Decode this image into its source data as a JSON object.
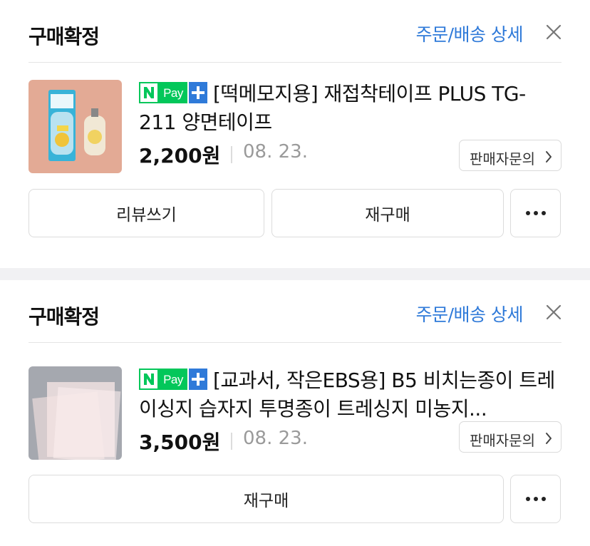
{
  "orders": [
    {
      "status": "구매확정",
      "detail_link": "주문/배송 상세",
      "npay_badge": {
        "n": "N",
        "pay": "Pay",
        "plus": "+"
      },
      "title": "[떡메모지용] 재접착테이프 PLUS TG-211 양면테이프",
      "price": "2,200원",
      "date": "08. 23.",
      "seller_inquiry": "판매자문의",
      "actions": [
        "리뷰쓰기",
        "재구매"
      ]
    },
    {
      "status": "구매확정",
      "detail_link": "주문/배송 상세",
      "npay_badge": {
        "n": "N",
        "pay": "Pay",
        "plus": "+"
      },
      "title": "[교과서, 작은EBS용] B5 비치는종이 트레이싱지 습자지 투명종이 트레싱지 미농지...",
      "price": "3,500원",
      "date": "08. 23.",
      "seller_inquiry": "판매자문의",
      "actions": [
        "재구매"
      ]
    }
  ],
  "colors": {
    "link": "#2f7ad9",
    "npay_green": "#03c75a",
    "npay_blue": "#2f7ad9",
    "section_gap": "#f1f1f3"
  },
  "icons": {
    "close": "close-icon",
    "chevron": "chevron-right-icon",
    "more": "more-dots-icon"
  }
}
